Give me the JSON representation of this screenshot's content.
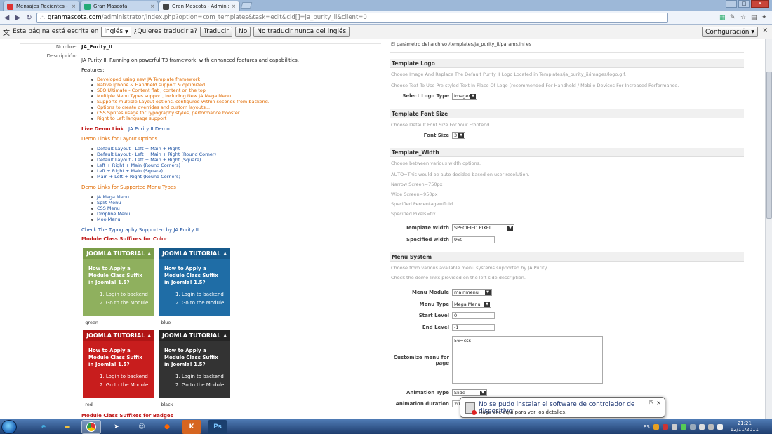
{
  "browser": {
    "tabs": [
      {
        "title": "Mensajes Recientes - web-c",
        "close": "×"
      },
      {
        "title": "Gran Mascota",
        "close": "×"
      },
      {
        "title": "Gran Mascota - Administra",
        "close": "×"
      }
    ],
    "url_host": "granmascota.com",
    "url_path": "/administrator/index.php?option=com_templates&task=edit&cid[]=ja_purity_ii&client=0"
  },
  "translate_bar": {
    "message": "Esta página está escrita en",
    "language": "inglés",
    "question": "¿Quieres traducirla?",
    "translate": "Traducir",
    "no": "No",
    "never": "No traducir nunca del inglés",
    "config": "Configuración"
  },
  "left": {
    "name_label": "Nombre:",
    "name_value": "JA_Purity_II",
    "desc_label": "Descripción:",
    "desc_intro": "JA Purity II, Running on powerful T3 framework, with enhanced features and capabilities.",
    "features_label": "Features:",
    "features": [
      "Developed using new JA Template framework",
      "Native Iphone & Handheld support & optimized",
      "SEO Ultimate - Content flat , content on the top",
      "Multiple Menu Types support, including New JA Mega Menu...",
      "Supports multiple Layout options, configured within seconds from backend.",
      "Options to create overrides and custom layouts...",
      "CSS Sprites usage for Typography styles, performance booster.",
      "Right to Left language support"
    ],
    "live_demo_label": "Live Demo Link",
    "live_demo_link": "JA Purity II Demo",
    "layout_heading": "Demo Links for Layout Options",
    "layouts": [
      "Default Layout - Left + Main + Right",
      "Default Layout - Left + Main + Right (Round Corner)",
      "Default Layout - Left + Main + Right (Square)",
      "Left + Right + Main (Round Corners)",
      "Left + Right + Main (Square)",
      "Main + Left + Right (Round Corners)"
    ],
    "menu_heading": "Demo Links for Supported Menu Types",
    "menus": [
      "JA Mega Menu",
      "Split Menu",
      "CSS Menu",
      "Dropline Menu",
      "Moo Menu"
    ],
    "typography_link": "Check The Typography Supported by JA Purity II",
    "suffix_heading": "Module Class Suffixes for Color",
    "badge_heading": "Module Class Suffixes for Badges",
    "modules": [
      {
        "header": "JOOMLA TUTORIAL",
        "body": "How to Apply a Module Class Suffix in Joomla! 1.5?",
        "step1": "1.   Login to backend",
        "step2": "2.   Go to the Module",
        "label": "_green",
        "color": "#8fb05e"
      },
      {
        "header": "JOOMLA TUTORIAL",
        "body": "How to Apply a Module Class Suffix in Joomla! 1.5?",
        "step1": "1.   Login to backend",
        "step2": "2.   Go to the Module",
        "label": "_blue",
        "color": "#1f6da6"
      },
      {
        "header": "JOOMLA TUTORIAL",
        "body": "How to Apply a Module Class Suffix in Joomla! 1.5?",
        "step1": "1.   Login to backend",
        "step2": "2.   Go to the Module",
        "label": "_red",
        "color": "#c81d1d"
      },
      {
        "header": "JOOMLA TUTORIAL",
        "body": "How to Apply a Module Class Suffix in Joomla! 1.5?",
        "step1": "1.   Login to backend",
        "step2": "2.   Go to the Module",
        "label": "_black",
        "color": "#333333"
      }
    ]
  },
  "right": {
    "param_file": "El parámetro del archivo /templates/ja_purity_ii/params.ini es",
    "logo_title": "Template Logo",
    "logo_desc1": "Choose Image And Replace The Default Purity II Logo Located in Templates/ja_purity_ii/images/logo.gif.",
    "logo_desc2": "Choose Text To Use Pre-styled Text In Place Of Logo (recommended For Handheld / Mobile Devices For Increased Performance.",
    "logo_type_label": "Select Logo Type",
    "logo_type_value": "Imagen",
    "font_title": "Template Font Size",
    "font_desc": "Choose Default Font Size For Your Frontend.",
    "font_label": "Font Size",
    "font_value": "3",
    "width_title": "Template_Width",
    "width_desc": [
      "Choose between various width options.",
      "AUTO=This would be auto decided based on user resolution.",
      "Narrow Screen=750px",
      "Wide Screen=950px",
      "Specified Percentage=fluid",
      "Specified Pixels=fix."
    ],
    "tw_label": "Template Width",
    "tw_value": "SPECIFIED PIXEL",
    "sw_label": "Specified width",
    "sw_value": "960",
    "menu_title": "Menu System",
    "menu_desc1": "Choose from various available menu systems supported by JA Purity.",
    "menu_desc2": "Check the demo links provided on the left side description.",
    "mm_label": "Menu Module",
    "mm_value": "mainmenu",
    "mt_label": "Menu Type",
    "mt_value": "Mega Menu",
    "sl_label": "Start Level",
    "sl_value": "0",
    "el_label": "End Level",
    "el_value": "-1",
    "cm_label": "Customize menu for page",
    "cm_value": "56=css",
    "at_label": "Animation Type",
    "at_value": "Slide",
    "ad_label": "Animation duration",
    "ad_value": "20"
  },
  "notification": {
    "title": "No se pudo instalar el software de controlador de dispositivo",
    "detail": "Haga clic aquí para ver los detalles.",
    "close": "×"
  },
  "taskbar": {
    "lang": "ES",
    "time": "21:21",
    "date": "12/11/2011"
  }
}
